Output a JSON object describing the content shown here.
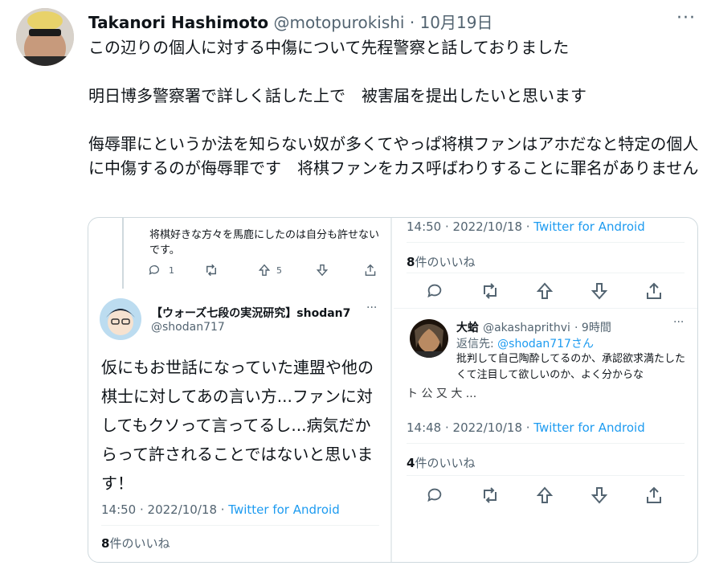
{
  "tweet": {
    "display_name": "Takanori Hashimoto",
    "handle": "@motopurokishi",
    "separator": "·",
    "date": "10月19日",
    "more": "···",
    "text": "この辺りの個人に対する中傷について先程警察と話しておりました\n\n明日博多警察署で詳しく話した上で　被害届を提出したいと思います\n\n侮辱罪にというか法を知らない奴が多くてやっぱ将棋ファンはアホだなと特定の個人に中傷するのが侮辱罪です　将棋ファンをカス呼ばわりすることに罪名がありません"
  },
  "left_panel": {
    "prev_text": "将棋好きな方々を馬鹿にしたのは自分も許せないです。",
    "reply_count": "1",
    "like_count": "5",
    "user_name": "【ウォーズ七段の実況研究】shodan7",
    "user_handle": "@shodan717",
    "more": "···",
    "text": "仮にもお世話になっていた連盟や他の棋士に対してあの言い方...ファンに対してもクソって言ってるし...病気だからって許されることではないと思います！",
    "time": "14:50 · 2022/10/18 · ",
    "source": "Twitter for Android",
    "likes_num": "8",
    "likes_label": "件のいいね"
  },
  "right_panel": {
    "top_time": "14:50 · 2022/10/18 · ",
    "top_source": "Twitter for Android",
    "top_likes_num": "8",
    "top_likes_label": "件のいいね",
    "reply_user_name": "大蛤",
    "reply_user_handle": "@akashaprithvi",
    "reply_time": "· 9時間",
    "replying_to_label": "返信先: ",
    "replying_to_handle": "@shodan717",
    "replying_to_suffix": "さん",
    "more": "···",
    "reply_text": "批判して自己陶酔してるのか、承認欲求満たしたくて注目して欲しいのか、よく分からな",
    "hidden_fragment": "ト 公 又 大 ...",
    "bottom_time": "14:48 · 2022/10/18 · ",
    "bottom_source": "Twitter for Android",
    "bottom_likes_num": "4",
    "bottom_likes_label": "件のいいね"
  },
  "colors": {
    "link": "#1d9bf0",
    "muted": "#536471",
    "border": "#cfd9de"
  }
}
